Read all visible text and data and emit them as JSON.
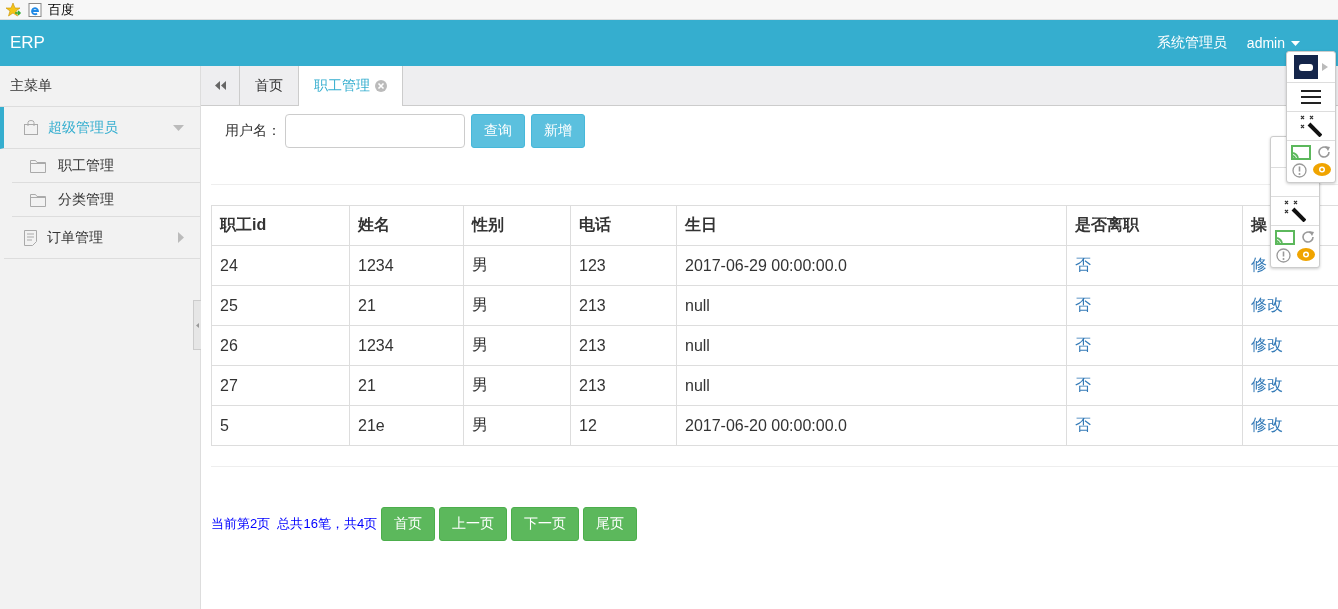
{
  "browser_bar": {
    "title": "百度"
  },
  "header": {
    "brand": "ERP",
    "role": "系统管理员",
    "user": "admin"
  },
  "sidebar": {
    "title": "主菜单",
    "items": [
      {
        "label": "超级管理员",
        "selected": true,
        "expanded": true,
        "children": [
          {
            "label": "职工管理",
            "selected": false
          },
          {
            "label": "分类管理",
            "selected": false
          }
        ]
      },
      {
        "label": "订单管理",
        "selected": false,
        "expanded": false
      }
    ]
  },
  "tabs": [
    {
      "label": "首页",
      "selected": false,
      "closable": false
    },
    {
      "label": "职工管理",
      "selected": true,
      "closable": true
    }
  ],
  "search": {
    "label": "用户名：",
    "buttons": [
      "查询",
      "新增"
    ]
  },
  "table": {
    "columns": [
      "职工id",
      "姓名",
      "性别",
      "电话",
      "生日",
      "是否离职",
      "操"
    ],
    "rows": [
      [
        "24",
        "1234",
        "男",
        "123",
        "2017-06-29 00:00:00.0",
        "否",
        "修"
      ],
      [
        "25",
        "21",
        "男",
        "213",
        "null",
        "否",
        "修改"
      ],
      [
        "26",
        "1234",
        "男",
        "213",
        "null",
        "否",
        "修改"
      ],
      [
        "27",
        "21",
        "男",
        "213",
        "null",
        "否",
        "修改"
      ],
      [
        "5",
        "21e",
        "男",
        "12",
        "2017-06-20 00:00:00.0",
        "否",
        "修改"
      ]
    ]
  },
  "pagination": {
    "info": "当前第2页  总共16笔，共4页",
    "buttons": [
      "首页",
      "上一页",
      "下一页",
      "尾页"
    ]
  }
}
